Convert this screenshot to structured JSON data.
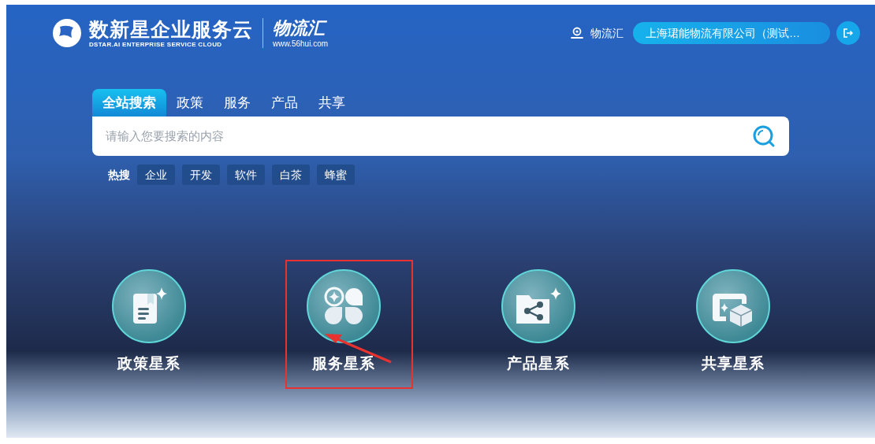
{
  "logo": {
    "title": "数新星企业服务云",
    "subtitle": "DSTAR.AI ENTERPRISE SERVICE CLOUD",
    "partner": "物流汇",
    "partner_url": "www.56hui.com"
  },
  "header": {
    "location": "物流汇",
    "company": "上海珺能物流有限公司（测试…"
  },
  "search": {
    "tabs": [
      {
        "label": "全站搜索",
        "selected": true
      },
      {
        "label": "政策",
        "selected": false
      },
      {
        "label": "服务",
        "selected": false
      },
      {
        "label": "产品",
        "selected": false
      },
      {
        "label": "共享",
        "selected": false
      }
    ],
    "placeholder": "请输入您要搜索的内容",
    "hot_label": "热搜",
    "hot_tags": [
      "企业",
      "开发",
      "软件",
      "白茶",
      "蜂蜜"
    ]
  },
  "galaxies": [
    {
      "kind": "policy",
      "label": "政策星系",
      "highlighted": false
    },
    {
      "kind": "service",
      "label": "服务星系",
      "highlighted": true
    },
    {
      "kind": "product",
      "label": "产品星系",
      "highlighted": false
    },
    {
      "kind": "share",
      "label": "共享星系",
      "highlighted": false
    }
  ]
}
